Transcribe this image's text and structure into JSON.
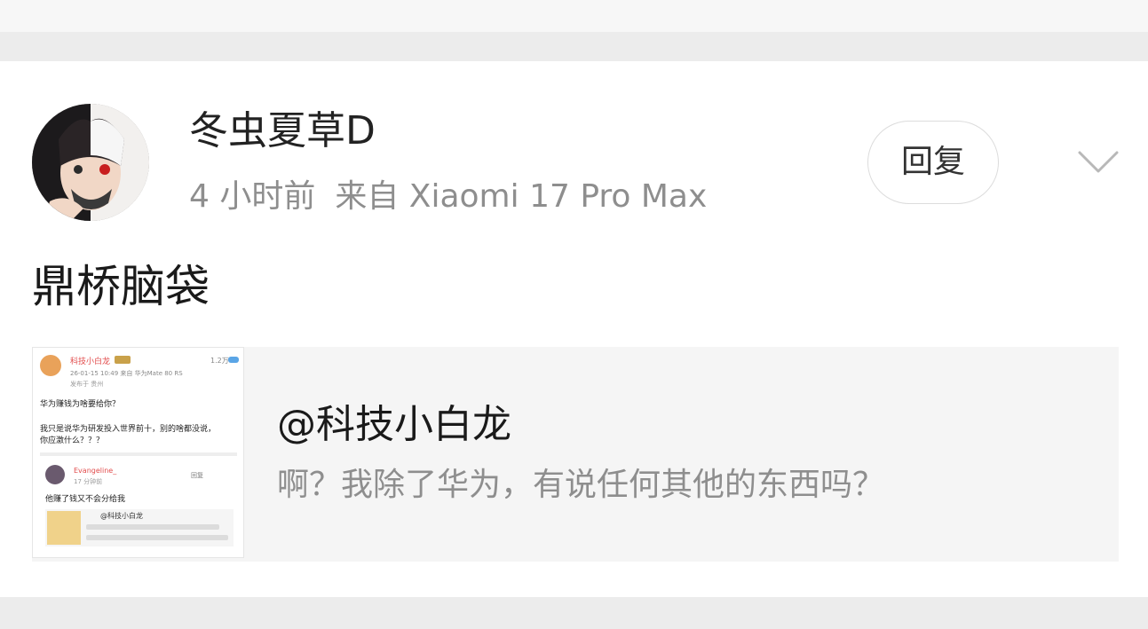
{
  "comment": {
    "username": "冬虫夏草D",
    "time": "4 小时前",
    "source": "来自 Xiaomi 17 Pro Max",
    "reply_label": "回复",
    "text": "鼎桥脑袋"
  },
  "quote": {
    "title": "@科技小白龙",
    "body": "啊？我除了华为，有说任何其他的东西吗？",
    "thumbnail": {
      "name": "科技小白龙",
      "count": "1.2万",
      "time": "26-01-15 10:49 来自 华为Mate 80 RS",
      "location": "发布于 贵州",
      "line1": "华为赚钱为啥要给你？",
      "line2": "我只是说华为研发投入世界前十，别的啥都没说，",
      "line3": "你应激什么？？？",
      "reply_name": "Evangeline_",
      "reply_label": "回复",
      "reply_time": "17 分钟前",
      "reply_text": "他赚了钱又不会分给我",
      "inner_title": "@科技小白龙"
    }
  },
  "icons": {
    "chevron": "chevron-down-icon",
    "avatar": "avatar"
  },
  "colors": {
    "text_primary": "#222222",
    "text_secondary": "#8e8e8e",
    "quote_bg": "#f5f5f5",
    "page_gap": "#ececec"
  }
}
